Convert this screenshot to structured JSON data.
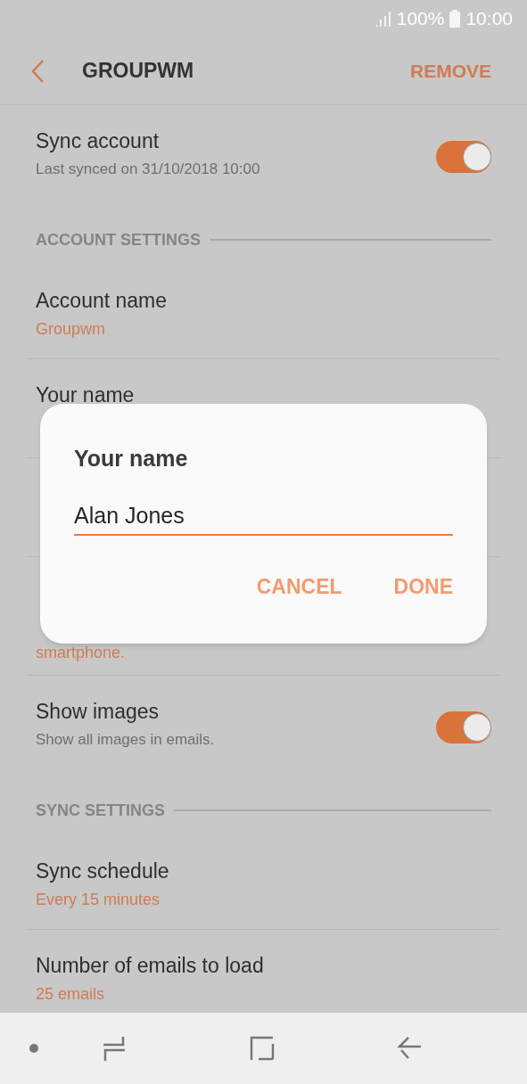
{
  "status_bar": {
    "battery": "100%",
    "time": "10:00"
  },
  "app_bar": {
    "title": "GROUPWM",
    "action": "REMOVE"
  },
  "items": [
    {
      "kind": "toggle",
      "title": "Sync account",
      "subtitle": "Last synced on 31/10/2018  10:00",
      "on": true
    },
    {
      "kind": "header",
      "title": "ACCOUNT SETTINGS"
    },
    {
      "kind": "value",
      "title": "Account name",
      "value": "Groupwm"
    },
    {
      "kind": "value",
      "title": "Your name"
    },
    {
      "kind": "covered"
    },
    {
      "kind": "value",
      "value_2": "smartphone."
    },
    {
      "kind": "toggle",
      "title": "Show images",
      "subtitle": "Show all images in emails.",
      "on": true
    },
    {
      "kind": "header",
      "title": "SYNC SETTINGS"
    },
    {
      "kind": "value",
      "title": "Sync schedule",
      "value": "Every 15 minutes"
    },
    {
      "kind": "value",
      "title": "Number of emails to load",
      "value": "25 emails"
    }
  ],
  "dialog": {
    "title": "Your name",
    "value": "Alan Jones",
    "buttons": [
      "CANCEL",
      "DONE"
    ]
  }
}
